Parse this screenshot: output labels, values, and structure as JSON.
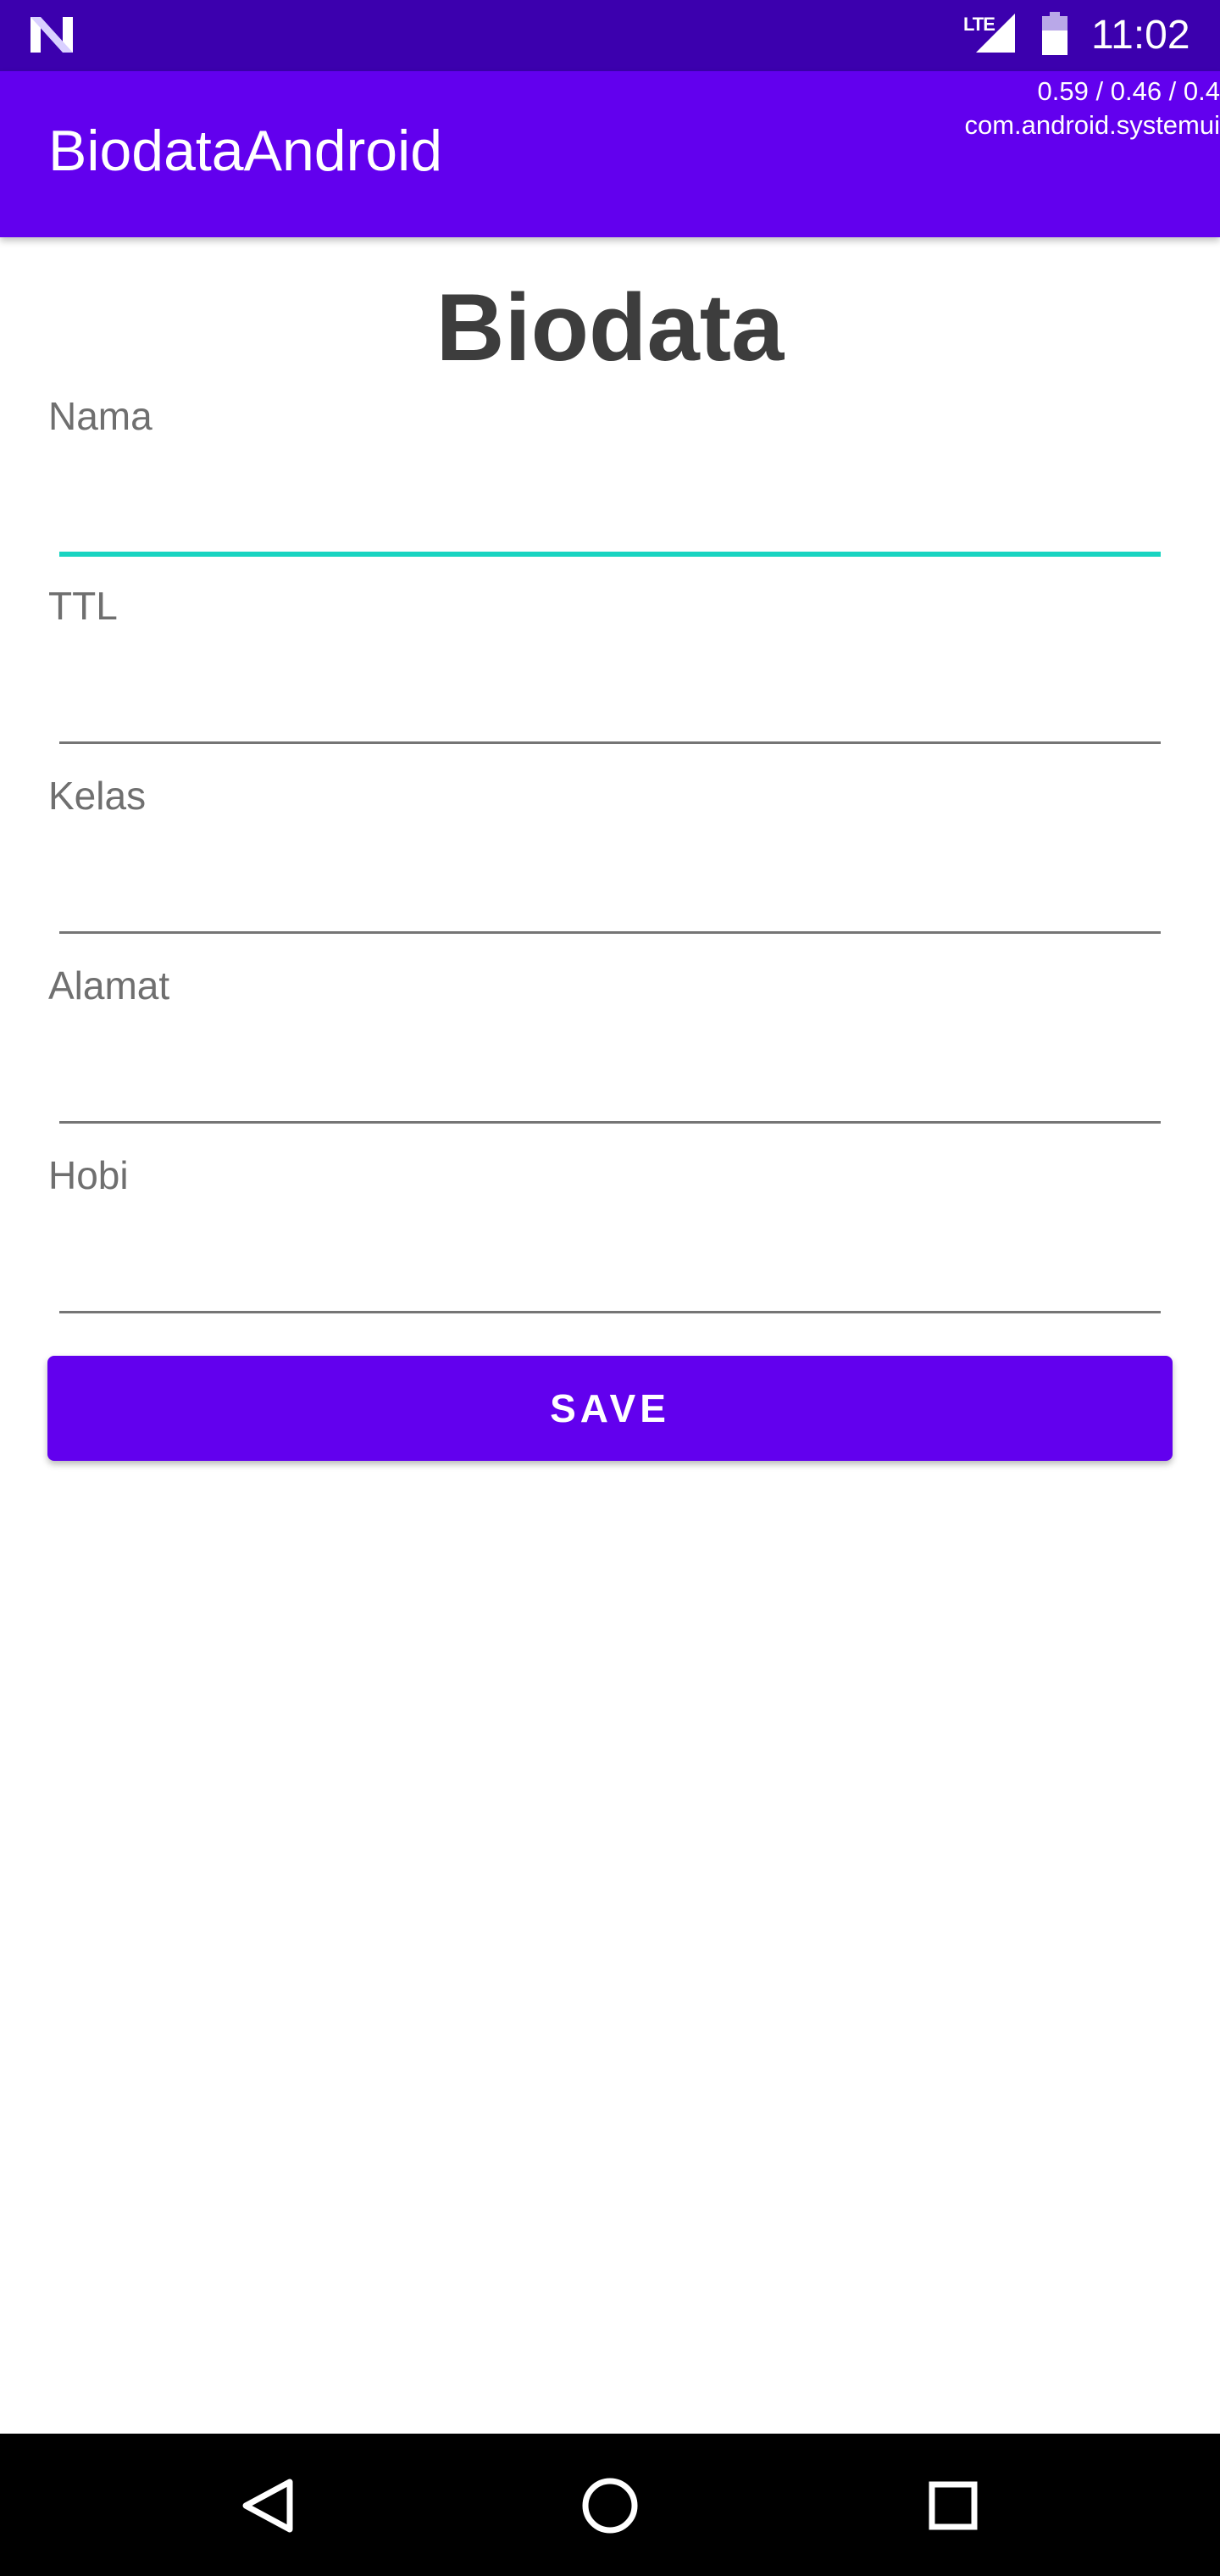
{
  "status_bar": {
    "network_label": "LTE",
    "time": "11:02",
    "colors": {
      "background": "#3c00ae"
    },
    "icons": [
      "n-logo-icon",
      "signal-icon",
      "battery-icon"
    ]
  },
  "app_bar": {
    "title": "BiodataAndroid",
    "debug_line_1": "0.59 / 0.46 / 0.4",
    "debug_line_2": "com.android.systemui",
    "colors": {
      "background": "#6200ee"
    }
  },
  "form": {
    "heading": "Biodata",
    "fields": [
      {
        "label": "Nama",
        "value": "",
        "focused": true
      },
      {
        "label": "TTL",
        "value": ""
      },
      {
        "label": "Kelas",
        "value": ""
      },
      {
        "label": "Alamat",
        "value": ""
      },
      {
        "label": "Hobi",
        "value": ""
      }
    ],
    "save_label": "SAVE",
    "colors": {
      "accent": "#6200ee",
      "focus_underline": "#19d4c1"
    }
  },
  "nav_bar": {
    "icons": [
      "back-icon",
      "home-icon",
      "recents-icon"
    ]
  }
}
